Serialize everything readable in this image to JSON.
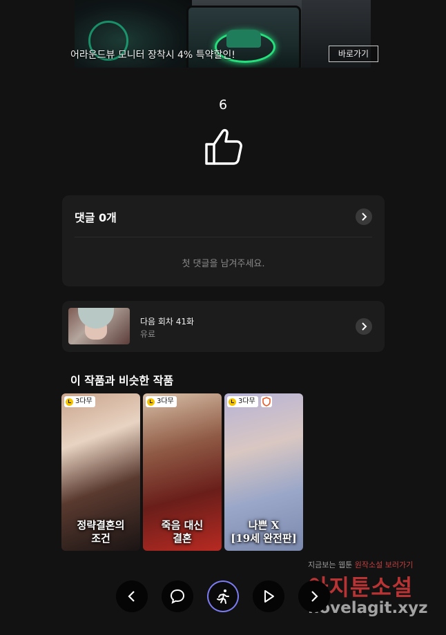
{
  "ad": {
    "text": "어라운드뷰 모니터 장착시 4% 특약할인!",
    "button_label": "바로가기"
  },
  "like": {
    "count": "6",
    "icon": "thumbs-up-icon"
  },
  "comments": {
    "title": "댓글 0개",
    "empty_text": "첫 댓글을 남겨주세요.",
    "arrow_icon": "chevron-right-icon"
  },
  "next_episode": {
    "title": "다음 회차 41화",
    "status": "유료",
    "arrow_icon": "chevron-right-icon"
  },
  "similar": {
    "title": "이 작품과 비슷한 작품",
    "items": [
      {
        "wait_label": "3다무",
        "name": "정략결혼의\n조건",
        "shield": false
      },
      {
        "wait_label": "3다무",
        "name": "죽음 대신\n결혼",
        "shield": false
      },
      {
        "wait_label": "3다무",
        "name": "나쁜 X\n[19세 완전판]",
        "shield": true
      }
    ]
  },
  "bottom_nav": [
    "chevron-left-icon",
    "comment-icon",
    "running-person-icon",
    "play-icon",
    "chevron-right-icon"
  ],
  "watermark": {
    "line1_prefix": "지금보는 웹툰",
    "line1_highlight": "원작소설",
    "line1_suffix": "보러가기",
    "brand": "아지툰소설",
    "domain": "novelagit.xyz"
  },
  "colors": {
    "background": "#121212",
    "card": "#1c1c1c",
    "active_ring": "#7b7cf2",
    "watermark_red": "#d63a3a"
  }
}
